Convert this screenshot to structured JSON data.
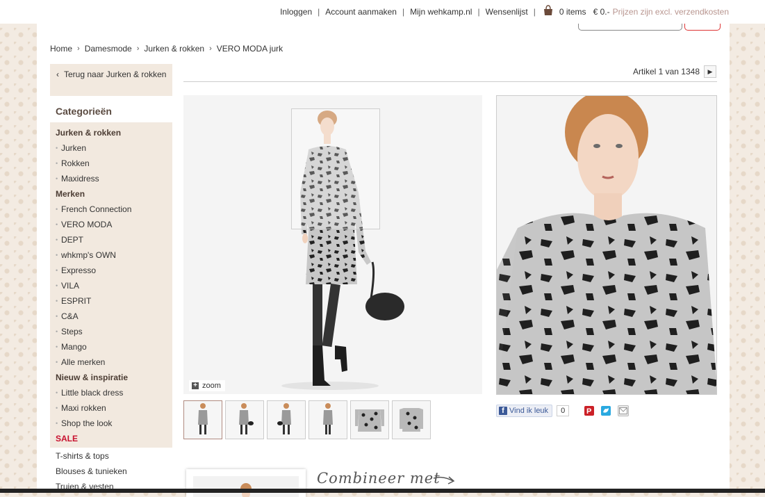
{
  "topbar": {
    "login": "Inloggen",
    "create_account": "Account aanmaken",
    "my_account": "Mijn wehkamp.nl",
    "wishlist": "Wensenlijst",
    "items": "0 items",
    "total": "€ 0.-",
    "shipping_note": "Prijzen zijn excl. verzendkosten"
  },
  "breadcrumb": [
    "Home",
    "Damesmode",
    "Jurken & rokken",
    "VERO MODA jurk"
  ],
  "sidebar": {
    "back_label": "Terug naar Jurken & rokken",
    "categories_title": "Categorieën",
    "groups": [
      {
        "title": "Jurken & rokken",
        "items": [
          "Jurken",
          "Rokken",
          "Maxidress"
        ]
      },
      {
        "title": "Merken",
        "items": [
          "French Connection",
          "VERO MODA",
          "DEPT",
          "whkmp's OWN",
          "Expresso",
          "VILA",
          "ESPRIT",
          "C&A",
          "Steps",
          "Mango",
          "Alle merken"
        ]
      },
      {
        "title": "Nieuw & inspiratie",
        "items": [
          "Little black dress",
          "Maxi rokken",
          "Shop the look"
        ]
      }
    ],
    "sale_label": "SALE",
    "other": [
      "T-shirts & tops",
      "Blouses & tunieken",
      "Truien & vesten"
    ]
  },
  "product": {
    "article_nav": "Artikel 1 van 1348",
    "zoom_label": "zoom",
    "thumbnail_count": 6,
    "active_thumbnail": 1
  },
  "social": {
    "like_label": "Vind ik leuk",
    "like_count": "0"
  },
  "combine_title": "Combineer met",
  "colors": {
    "sidebar_bg": "#f2e9df",
    "sale": "#c8102e",
    "shipping_note": "#b8958f",
    "facebook": "#3b5998",
    "pinterest": "#cb2027",
    "twitter": "#2aa9e0"
  }
}
